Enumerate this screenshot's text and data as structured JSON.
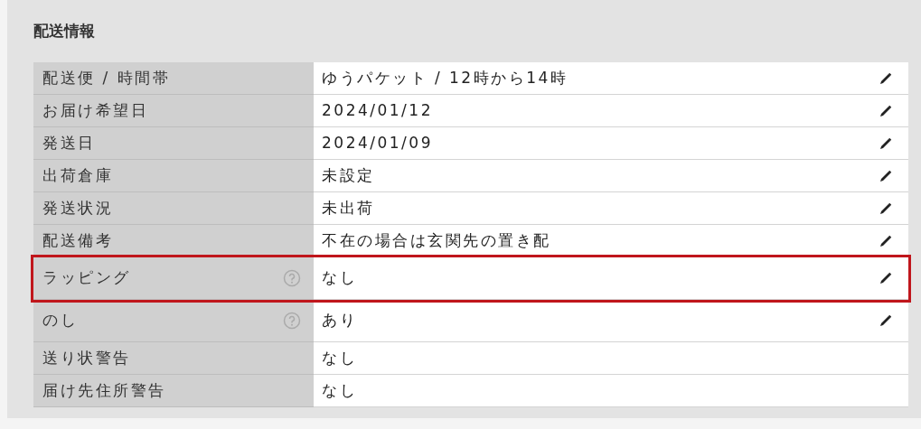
{
  "section": {
    "title": "配送情報"
  },
  "rows": [
    {
      "label": "配送便 / 時間帯",
      "value": "ゆうパケット / 12時から14時",
      "help": false,
      "editable": true,
      "highlighted": false
    },
    {
      "label": "お届け希望日",
      "value": "2024/01/12",
      "help": false,
      "editable": true,
      "highlighted": false
    },
    {
      "label": "発送日",
      "value": "2024/01/09",
      "help": false,
      "editable": true,
      "highlighted": false
    },
    {
      "label": "出荷倉庫",
      "value": "未設定",
      "help": false,
      "editable": true,
      "highlighted": false
    },
    {
      "label": "発送状況",
      "value": "未出荷",
      "help": false,
      "editable": true,
      "highlighted": false
    },
    {
      "label": "配送備考",
      "value": "不在の場合は玄関先の置き配",
      "help": false,
      "editable": true,
      "highlighted": false
    },
    {
      "label": "ラッピング",
      "value": "なし",
      "help": true,
      "editable": true,
      "highlighted": true
    },
    {
      "label": "のし",
      "value": "あり",
      "help": true,
      "editable": true,
      "highlighted": false
    },
    {
      "label": "送り状警告",
      "value": "なし",
      "help": false,
      "editable": false,
      "highlighted": false
    },
    {
      "label": "届け先住所警告",
      "value": "なし",
      "help": false,
      "editable": false,
      "highlighted": false
    }
  ]
}
